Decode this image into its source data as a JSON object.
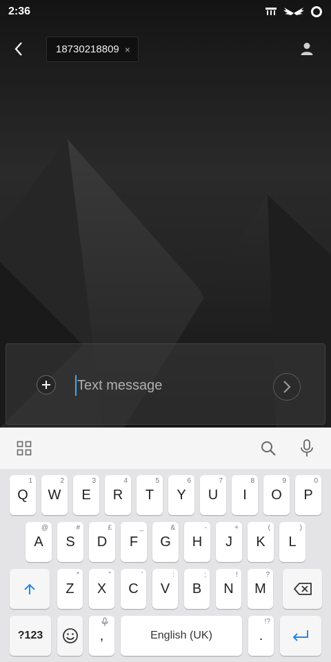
{
  "status_bar": {
    "time": "2:36"
  },
  "top_bar": {
    "recipient": "18730218809",
    "remove_label": "×"
  },
  "composer": {
    "placeholder": "Text message"
  },
  "keyboard": {
    "rows": [
      [
        {
          "label": "Q",
          "hint": "1"
        },
        {
          "label": "W",
          "hint": "2"
        },
        {
          "label": "E",
          "hint": "3"
        },
        {
          "label": "R",
          "hint": "4"
        },
        {
          "label": "T",
          "hint": "5"
        },
        {
          "label": "Y",
          "hint": "6"
        },
        {
          "label": "U",
          "hint": "7"
        },
        {
          "label": "I",
          "hint": "8"
        },
        {
          "label": "O",
          "hint": "9"
        },
        {
          "label": "P",
          "hint": "0"
        }
      ],
      [
        {
          "label": "A",
          "hint": "@"
        },
        {
          "label": "S",
          "hint": "#"
        },
        {
          "label": "D",
          "hint": "£"
        },
        {
          "label": "F",
          "hint": "_"
        },
        {
          "label": "G",
          "hint": "&"
        },
        {
          "label": "H",
          "hint": "-"
        },
        {
          "label": "J",
          "hint": "+"
        },
        {
          "label": "K",
          "hint": "("
        },
        {
          "label": "L",
          "hint": ")"
        }
      ],
      [
        {
          "label": "Z",
          "hint": "*"
        },
        {
          "label": "X",
          "hint": "\""
        },
        {
          "label": "C",
          "hint": "'"
        },
        {
          "label": "V",
          "hint": ":"
        },
        {
          "label": "B",
          "hint": ";"
        },
        {
          "label": "N",
          "hint": "!"
        },
        {
          "label": "M",
          "hint": "?"
        }
      ]
    ],
    "symbols_key": "?123",
    "comma_key": ",",
    "space_key": "English (UK)",
    "period_key": ".",
    "period_hint": "!?"
  },
  "colors": {
    "accent": "#3fa9f5",
    "keyboard_bg": "#e4e4e6",
    "key_bg": "#ffffff"
  },
  "icons": [
    "back-arrow-icon",
    "person-icon",
    "plus-icon",
    "send-chevron-icon",
    "apps-grid-icon",
    "search-icon",
    "microphone-icon",
    "shift-arrow-icon",
    "backspace-icon",
    "emoji-icon",
    "enter-arrow-icon"
  ]
}
